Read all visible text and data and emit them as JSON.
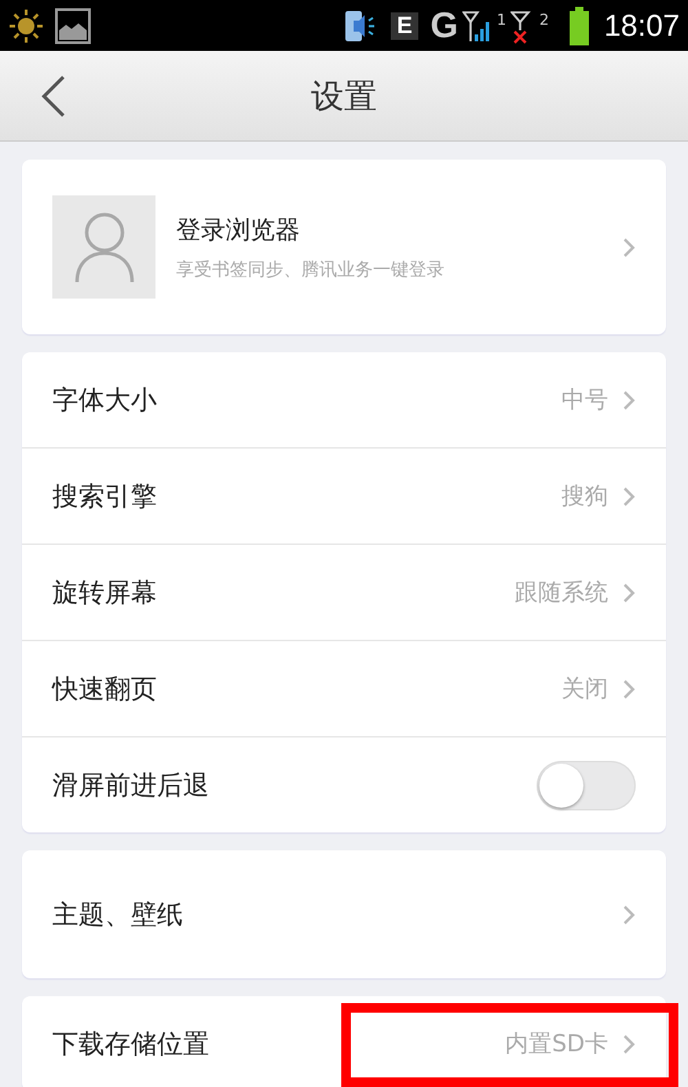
{
  "status_bar": {
    "data_type": "E",
    "network": "G",
    "sim1": "1",
    "sim2": "2",
    "time": "18:07"
  },
  "header": {
    "title": "设置"
  },
  "account": {
    "title": "登录浏览器",
    "subtitle": "享受书签同步、腾讯业务一键登录"
  },
  "groups": [
    {
      "items": [
        {
          "kind": "value",
          "label": "字体大小",
          "value": "中号"
        },
        {
          "kind": "value",
          "label": "搜索引擎",
          "value": "搜狗"
        },
        {
          "kind": "value",
          "label": "旋转屏幕",
          "value": "跟随系统"
        },
        {
          "kind": "value",
          "label": "快速翻页",
          "value": "关闭"
        },
        {
          "kind": "toggle",
          "label": "滑屏前进后退",
          "on": false
        }
      ]
    },
    {
      "items": [
        {
          "kind": "link",
          "label": "主题、壁纸"
        }
      ]
    },
    {
      "items": [
        {
          "kind": "value",
          "label": "下载存储位置",
          "value": "内置SD卡",
          "highlighted": true
        }
      ]
    }
  ]
}
